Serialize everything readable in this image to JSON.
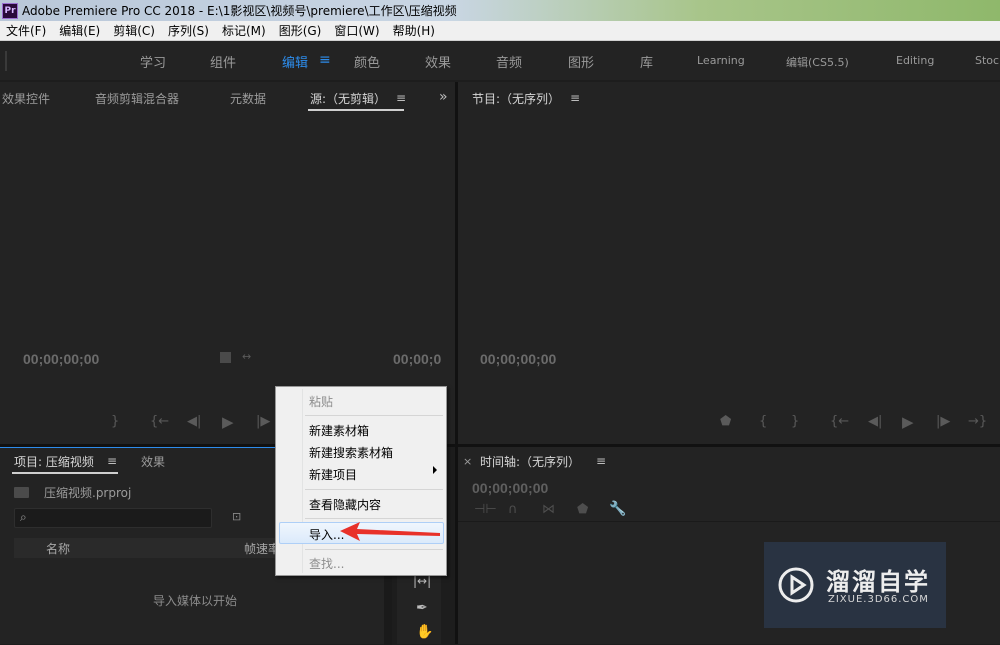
{
  "window": {
    "app_icon_label": "Pr",
    "title": "Adobe Premiere Pro CC 2018 - E:\\1影视区\\视频号\\premiere\\工作区\\压缩视频"
  },
  "menubar": {
    "items": [
      "文件(F)",
      "编辑(E)",
      "剪辑(C)",
      "序列(S)",
      "标记(M)",
      "图形(G)",
      "窗口(W)",
      "帮助(H)"
    ]
  },
  "workspaces": {
    "tabs": [
      "学习",
      "组件",
      "编辑",
      "颜色",
      "效果",
      "音频",
      "图形",
      "库",
      "Learning",
      "编辑(CS5.5)",
      "Editing",
      "Stock"
    ],
    "active": "编辑",
    "menu_glyph": "≡"
  },
  "source_panel": {
    "tabs": [
      "效果控件",
      "音频剪辑混合器",
      "元数据",
      "源:（无剪辑）"
    ],
    "active_tab": "源:（无剪辑）",
    "menu_glyph": "≡",
    "overflow_glyph": "»",
    "timecode_left": "00;00;00;00",
    "timecode_right": "00;00;0"
  },
  "program_panel": {
    "tab": "节目:（无序列）",
    "menu_glyph": "≡",
    "timecode": "00;00;00;00"
  },
  "project_panel": {
    "tabs": [
      "项目: 压缩视频",
      "效果"
    ],
    "menu_glyph": "≡",
    "file_name": "压缩视频.prproj",
    "columns": [
      "名称",
      "帧速率"
    ],
    "empty_message": "导入媒体以开始"
  },
  "timeline_panel": {
    "close_glyph": "×",
    "tab": "时间轴:（无序列）",
    "menu_glyph": "≡",
    "timecode": "00;00;00;00"
  },
  "context_menu": {
    "items": [
      {
        "label": "粘贴",
        "enabled": false
      },
      {
        "label": "新建素材箱",
        "enabled": true
      },
      {
        "label": "新建搜索素材箱",
        "enabled": true
      },
      {
        "label": "新建项目",
        "enabled": true,
        "submenu": true
      },
      {
        "label": "查看隐藏内容",
        "enabled": true
      },
      {
        "label": "导入...",
        "enabled": true,
        "highlighted": true
      },
      {
        "label": "查找...",
        "enabled": false
      }
    ]
  },
  "watermark": {
    "brand": "溜溜自学",
    "url": "ZIXUE.3D66.COM"
  },
  "colors": {
    "accent_blue": "#2d8ceb",
    "annotation_arrow": "#e8312a"
  }
}
